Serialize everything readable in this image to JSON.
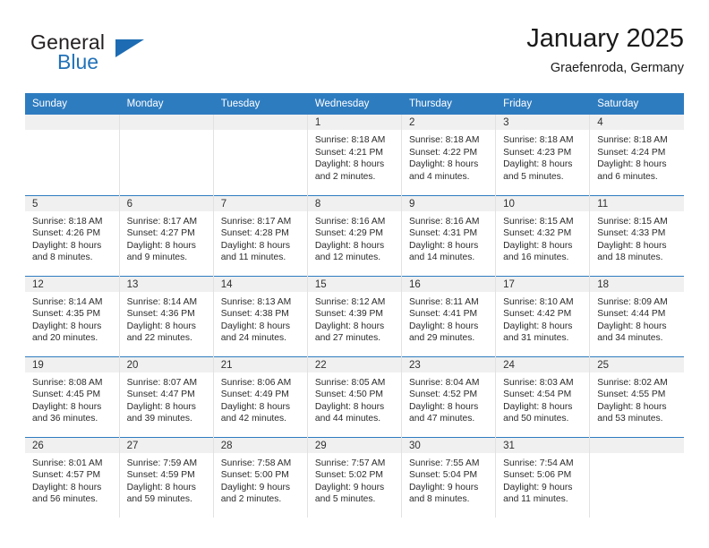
{
  "brand": {
    "word1": "General",
    "word2": "Blue",
    "triangle_color": "#1d6cb3",
    "text_color": "#231f20"
  },
  "header": {
    "title": "January 2025",
    "subtitle": "Graefenroda, Germany"
  },
  "theme": {
    "header_bg": "#2e7cc0",
    "header_text": "#ffffff",
    "daynum_bg": "#f0f0f0",
    "cell_border": "#e2e2e2"
  },
  "weekday_headers": [
    "Sunday",
    "Monday",
    "Tuesday",
    "Wednesday",
    "Thursday",
    "Friday",
    "Saturday"
  ],
  "weeks": [
    [
      {
        "day": "",
        "empty": true,
        "sunrise": "",
        "sunset": "",
        "daylight1": "",
        "daylight2": ""
      },
      {
        "day": "",
        "empty": true,
        "sunrise": "",
        "sunset": "",
        "daylight1": "",
        "daylight2": ""
      },
      {
        "day": "",
        "empty": true,
        "sunrise": "",
        "sunset": "",
        "daylight1": "",
        "daylight2": ""
      },
      {
        "day": "1",
        "empty": false,
        "sunrise": "Sunrise: 8:18 AM",
        "sunset": "Sunset: 4:21 PM",
        "daylight1": "Daylight: 8 hours",
        "daylight2": "and 2 minutes."
      },
      {
        "day": "2",
        "empty": false,
        "sunrise": "Sunrise: 8:18 AM",
        "sunset": "Sunset: 4:22 PM",
        "daylight1": "Daylight: 8 hours",
        "daylight2": "and 4 minutes."
      },
      {
        "day": "3",
        "empty": false,
        "sunrise": "Sunrise: 8:18 AM",
        "sunset": "Sunset: 4:23 PM",
        "daylight1": "Daylight: 8 hours",
        "daylight2": "and 5 minutes."
      },
      {
        "day": "4",
        "empty": false,
        "sunrise": "Sunrise: 8:18 AM",
        "sunset": "Sunset: 4:24 PM",
        "daylight1": "Daylight: 8 hours",
        "daylight2": "and 6 minutes."
      }
    ],
    [
      {
        "day": "5",
        "empty": false,
        "sunrise": "Sunrise: 8:18 AM",
        "sunset": "Sunset: 4:26 PM",
        "daylight1": "Daylight: 8 hours",
        "daylight2": "and 8 minutes."
      },
      {
        "day": "6",
        "empty": false,
        "sunrise": "Sunrise: 8:17 AM",
        "sunset": "Sunset: 4:27 PM",
        "daylight1": "Daylight: 8 hours",
        "daylight2": "and 9 minutes."
      },
      {
        "day": "7",
        "empty": false,
        "sunrise": "Sunrise: 8:17 AM",
        "sunset": "Sunset: 4:28 PM",
        "daylight1": "Daylight: 8 hours",
        "daylight2": "and 11 minutes."
      },
      {
        "day": "8",
        "empty": false,
        "sunrise": "Sunrise: 8:16 AM",
        "sunset": "Sunset: 4:29 PM",
        "daylight1": "Daylight: 8 hours",
        "daylight2": "and 12 minutes."
      },
      {
        "day": "9",
        "empty": false,
        "sunrise": "Sunrise: 8:16 AM",
        "sunset": "Sunset: 4:31 PM",
        "daylight1": "Daylight: 8 hours",
        "daylight2": "and 14 minutes."
      },
      {
        "day": "10",
        "empty": false,
        "sunrise": "Sunrise: 8:15 AM",
        "sunset": "Sunset: 4:32 PM",
        "daylight1": "Daylight: 8 hours",
        "daylight2": "and 16 minutes."
      },
      {
        "day": "11",
        "empty": false,
        "sunrise": "Sunrise: 8:15 AM",
        "sunset": "Sunset: 4:33 PM",
        "daylight1": "Daylight: 8 hours",
        "daylight2": "and 18 minutes."
      }
    ],
    [
      {
        "day": "12",
        "empty": false,
        "sunrise": "Sunrise: 8:14 AM",
        "sunset": "Sunset: 4:35 PM",
        "daylight1": "Daylight: 8 hours",
        "daylight2": "and 20 minutes."
      },
      {
        "day": "13",
        "empty": false,
        "sunrise": "Sunrise: 8:14 AM",
        "sunset": "Sunset: 4:36 PM",
        "daylight1": "Daylight: 8 hours",
        "daylight2": "and 22 minutes."
      },
      {
        "day": "14",
        "empty": false,
        "sunrise": "Sunrise: 8:13 AM",
        "sunset": "Sunset: 4:38 PM",
        "daylight1": "Daylight: 8 hours",
        "daylight2": "and 24 minutes."
      },
      {
        "day": "15",
        "empty": false,
        "sunrise": "Sunrise: 8:12 AM",
        "sunset": "Sunset: 4:39 PM",
        "daylight1": "Daylight: 8 hours",
        "daylight2": "and 27 minutes."
      },
      {
        "day": "16",
        "empty": false,
        "sunrise": "Sunrise: 8:11 AM",
        "sunset": "Sunset: 4:41 PM",
        "daylight1": "Daylight: 8 hours",
        "daylight2": "and 29 minutes."
      },
      {
        "day": "17",
        "empty": false,
        "sunrise": "Sunrise: 8:10 AM",
        "sunset": "Sunset: 4:42 PM",
        "daylight1": "Daylight: 8 hours",
        "daylight2": "and 31 minutes."
      },
      {
        "day": "18",
        "empty": false,
        "sunrise": "Sunrise: 8:09 AM",
        "sunset": "Sunset: 4:44 PM",
        "daylight1": "Daylight: 8 hours",
        "daylight2": "and 34 minutes."
      }
    ],
    [
      {
        "day": "19",
        "empty": false,
        "sunrise": "Sunrise: 8:08 AM",
        "sunset": "Sunset: 4:45 PM",
        "daylight1": "Daylight: 8 hours",
        "daylight2": "and 36 minutes."
      },
      {
        "day": "20",
        "empty": false,
        "sunrise": "Sunrise: 8:07 AM",
        "sunset": "Sunset: 4:47 PM",
        "daylight1": "Daylight: 8 hours",
        "daylight2": "and 39 minutes."
      },
      {
        "day": "21",
        "empty": false,
        "sunrise": "Sunrise: 8:06 AM",
        "sunset": "Sunset: 4:49 PM",
        "daylight1": "Daylight: 8 hours",
        "daylight2": "and 42 minutes."
      },
      {
        "day": "22",
        "empty": false,
        "sunrise": "Sunrise: 8:05 AM",
        "sunset": "Sunset: 4:50 PM",
        "daylight1": "Daylight: 8 hours",
        "daylight2": "and 44 minutes."
      },
      {
        "day": "23",
        "empty": false,
        "sunrise": "Sunrise: 8:04 AM",
        "sunset": "Sunset: 4:52 PM",
        "daylight1": "Daylight: 8 hours",
        "daylight2": "and 47 minutes."
      },
      {
        "day": "24",
        "empty": false,
        "sunrise": "Sunrise: 8:03 AM",
        "sunset": "Sunset: 4:54 PM",
        "daylight1": "Daylight: 8 hours",
        "daylight2": "and 50 minutes."
      },
      {
        "day": "25",
        "empty": false,
        "sunrise": "Sunrise: 8:02 AM",
        "sunset": "Sunset: 4:55 PM",
        "daylight1": "Daylight: 8 hours",
        "daylight2": "and 53 minutes."
      }
    ],
    [
      {
        "day": "26",
        "empty": false,
        "sunrise": "Sunrise: 8:01 AM",
        "sunset": "Sunset: 4:57 PM",
        "daylight1": "Daylight: 8 hours",
        "daylight2": "and 56 minutes."
      },
      {
        "day": "27",
        "empty": false,
        "sunrise": "Sunrise: 7:59 AM",
        "sunset": "Sunset: 4:59 PM",
        "daylight1": "Daylight: 8 hours",
        "daylight2": "and 59 minutes."
      },
      {
        "day": "28",
        "empty": false,
        "sunrise": "Sunrise: 7:58 AM",
        "sunset": "Sunset: 5:00 PM",
        "daylight1": "Daylight: 9 hours",
        "daylight2": "and 2 minutes."
      },
      {
        "day": "29",
        "empty": false,
        "sunrise": "Sunrise: 7:57 AM",
        "sunset": "Sunset: 5:02 PM",
        "daylight1": "Daylight: 9 hours",
        "daylight2": "and 5 minutes."
      },
      {
        "day": "30",
        "empty": false,
        "sunrise": "Sunrise: 7:55 AM",
        "sunset": "Sunset: 5:04 PM",
        "daylight1": "Daylight: 9 hours",
        "daylight2": "and 8 minutes."
      },
      {
        "day": "31",
        "empty": false,
        "sunrise": "Sunrise: 7:54 AM",
        "sunset": "Sunset: 5:06 PM",
        "daylight1": "Daylight: 9 hours",
        "daylight2": "and 11 minutes."
      },
      {
        "day": "",
        "empty": true,
        "sunrise": "",
        "sunset": "",
        "daylight1": "",
        "daylight2": ""
      }
    ]
  ]
}
